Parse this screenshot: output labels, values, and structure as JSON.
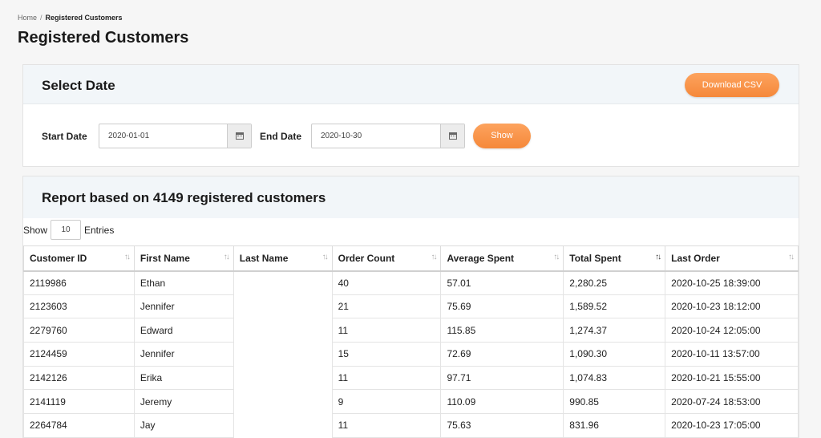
{
  "breadcrumb": {
    "home": "Home",
    "separator": "/",
    "current": "Registered Customers"
  },
  "page_title": "Registered Customers",
  "date_card": {
    "title": "Select Date",
    "download_label": "Download CSV",
    "start_label": "Start Date",
    "start_value": "2020-01-01",
    "end_label": "End Date",
    "end_value": "2020-10-30",
    "show_label": "Show",
    "calendar_icon": "calendar-icon"
  },
  "report": {
    "title": "Report based on 4149 registered customers",
    "show_label": "Show",
    "entries_value": "10",
    "entries_label": "Entries",
    "columns": [
      "Customer ID",
      "First Name",
      "Last Name",
      "Order Count",
      "Average Spent",
      "Total Spent",
      "Last Order"
    ],
    "sort_icons": [
      "↑↓",
      "↑↓",
      "↑↓",
      "↑↓",
      "↑↓",
      "↑↓",
      "↑↓"
    ],
    "rows": [
      [
        "2119986",
        "Ethan",
        "",
        "40",
        "57.01",
        "2,280.25",
        "2020-10-25 18:39:00"
      ],
      [
        "2123603",
        "Jennifer",
        "",
        "21",
        "75.69",
        "1,589.52",
        "2020-10-23 18:12:00"
      ],
      [
        "2279760",
        "Edward",
        "",
        "11",
        "115.85",
        "1,274.37",
        "2020-10-24 12:05:00"
      ],
      [
        "2124459",
        "Jennifer",
        "",
        "15",
        "72.69",
        "1,090.30",
        "2020-10-11 13:57:00"
      ],
      [
        "2142126",
        "Erika",
        "",
        "11",
        "97.71",
        "1,074.83",
        "2020-10-21 15:55:00"
      ],
      [
        "2141119",
        "Jeremy",
        "",
        "9",
        "110.09",
        "990.85",
        "2020-07-24 18:53:00"
      ],
      [
        "2264784",
        "Jay",
        "",
        "11",
        "75.63",
        "831.96",
        "2020-10-23 17:05:00"
      ]
    ]
  },
  "colors": {
    "accent": "#f5883a",
    "header_bg": "#f2f6f9"
  }
}
